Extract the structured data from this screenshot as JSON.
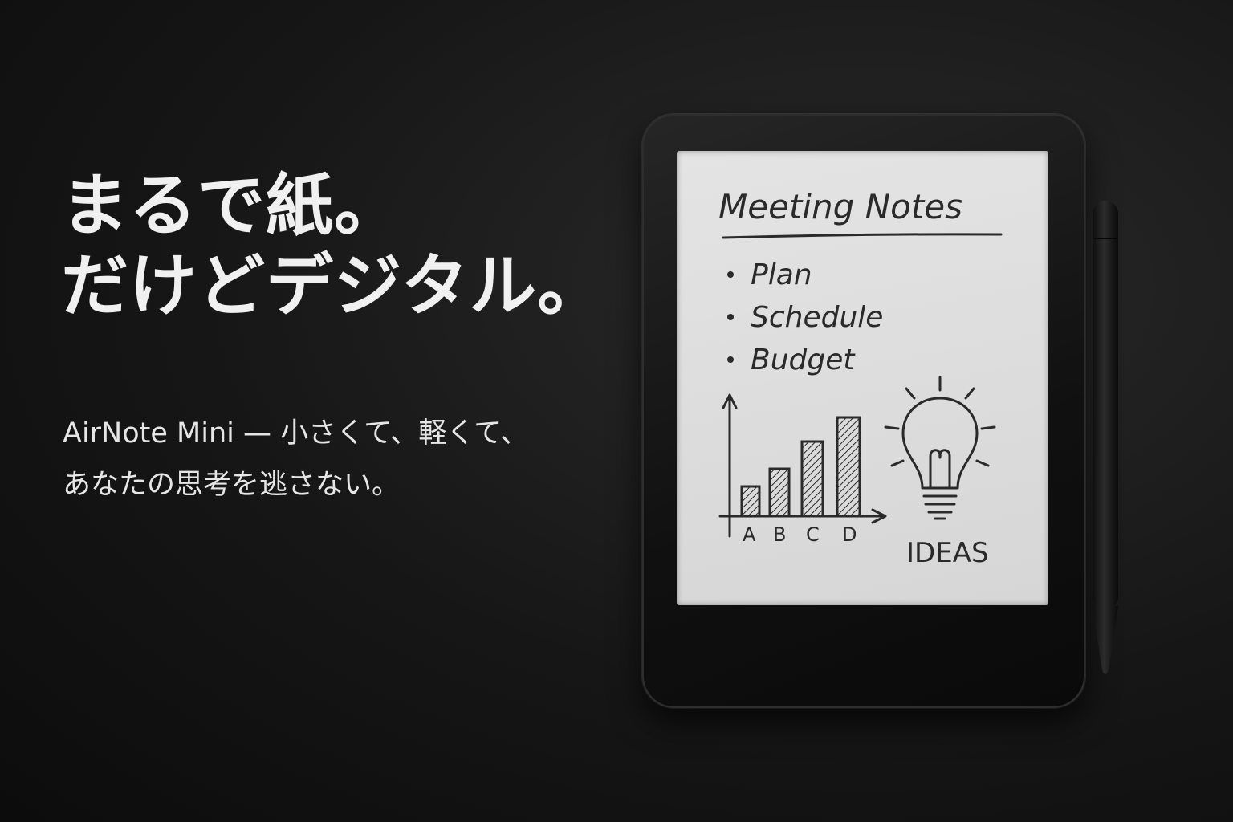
{
  "hero": {
    "headline_line1": "まるで紙。",
    "headline_line2": "だけどデジタル。",
    "subtitle_line1": "AirNote Mini — 小さくて、軽くて、",
    "subtitle_line2": "あなたの思考を逃さない。"
  },
  "device": {
    "screen": {
      "title": "Meeting Notes",
      "bullets": [
        "Plan",
        "Schedule",
        "Budget"
      ],
      "chart_labels": [
        "A",
        "B",
        "C",
        "D"
      ],
      "ideas_label": "IDEAS"
    }
  },
  "colors": {
    "background": "#161616",
    "text": "#f0f0f0",
    "screen": "#dcdcdc",
    "ink": "#2a2a2a"
  }
}
